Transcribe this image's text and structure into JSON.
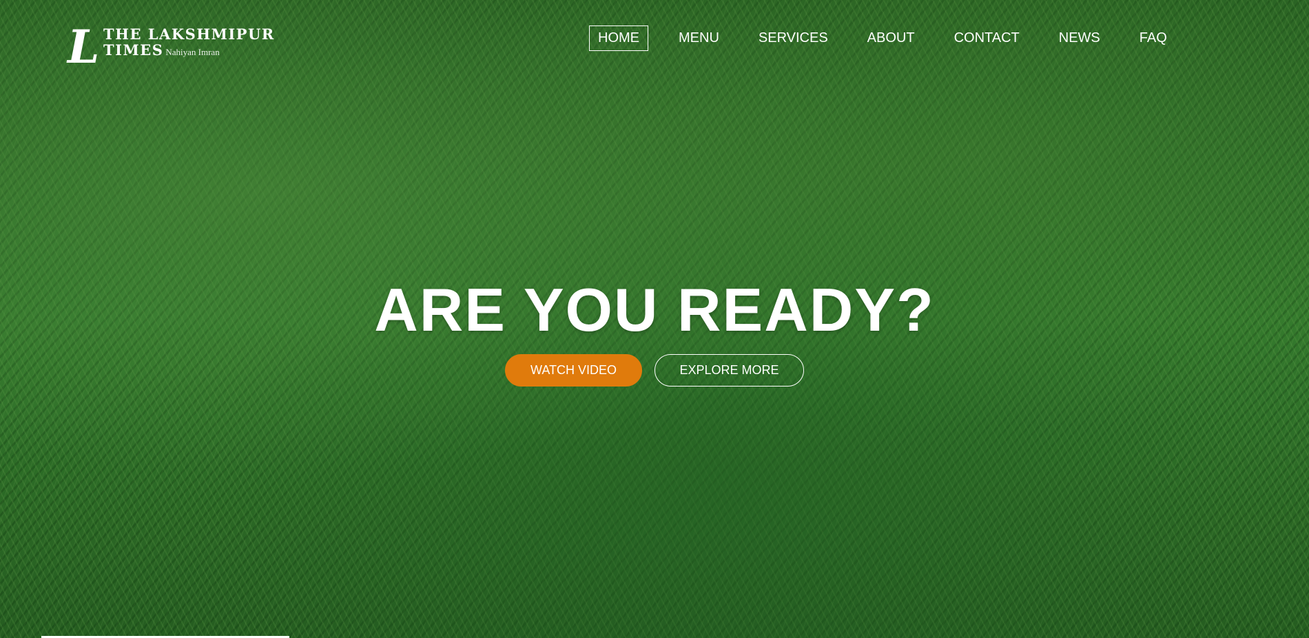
{
  "logo": {
    "mark": "L",
    "line1": "THE LAKSHMIPUR",
    "line2": "TIMES",
    "sub": "Nahiyan Imran"
  },
  "nav": {
    "items": [
      {
        "label": "HOME",
        "active": true
      },
      {
        "label": "MENU",
        "active": false
      },
      {
        "label": "SERVICES",
        "active": false
      },
      {
        "label": "ABOUT",
        "active": false
      },
      {
        "label": "CONTACT",
        "active": false
      },
      {
        "label": "NEWS",
        "active": false
      },
      {
        "label": "FAQ",
        "active": false
      }
    ]
  },
  "hero": {
    "title": "ARE YOU READY?",
    "primary_button": "WATCH VIDEO",
    "secondary_button": "EXPLORE MORE"
  },
  "colors": {
    "accent": "#e07b0c",
    "text": "#ffffff",
    "background": "#2f7a2a"
  }
}
